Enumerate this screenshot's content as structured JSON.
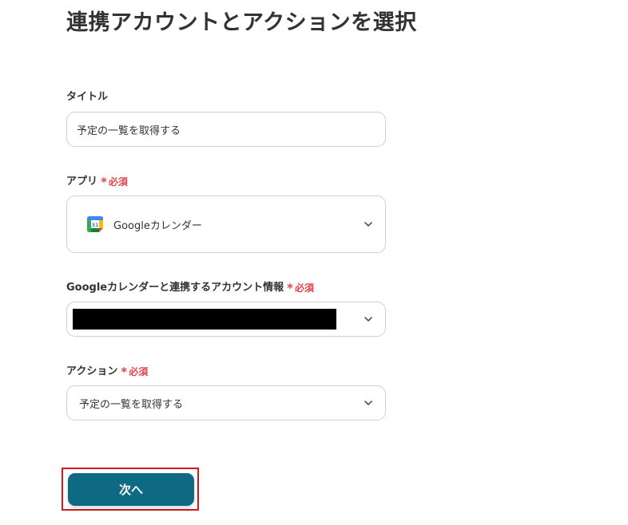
{
  "page": {
    "title": "連携アカウントとアクションを選択"
  },
  "fields": {
    "title": {
      "label": "タイトル",
      "value": "予定の一覧を取得する"
    },
    "app": {
      "label": "アプリ",
      "required": "必須",
      "value": "Googleカレンダー",
      "icon": "google-calendar-icon",
      "icon_text": "31"
    },
    "account": {
      "label": "Googleカレンダーと連携するアカウント情報",
      "required": "必須",
      "value_redacted": true
    },
    "action": {
      "label": "アクション",
      "required": "必須",
      "value": "予定の一覧を取得する"
    }
  },
  "buttons": {
    "next": "次へ"
  },
  "colors": {
    "primary": "#0d6a82",
    "required": "#e0454f",
    "highlight_border": "#d31a1a"
  }
}
